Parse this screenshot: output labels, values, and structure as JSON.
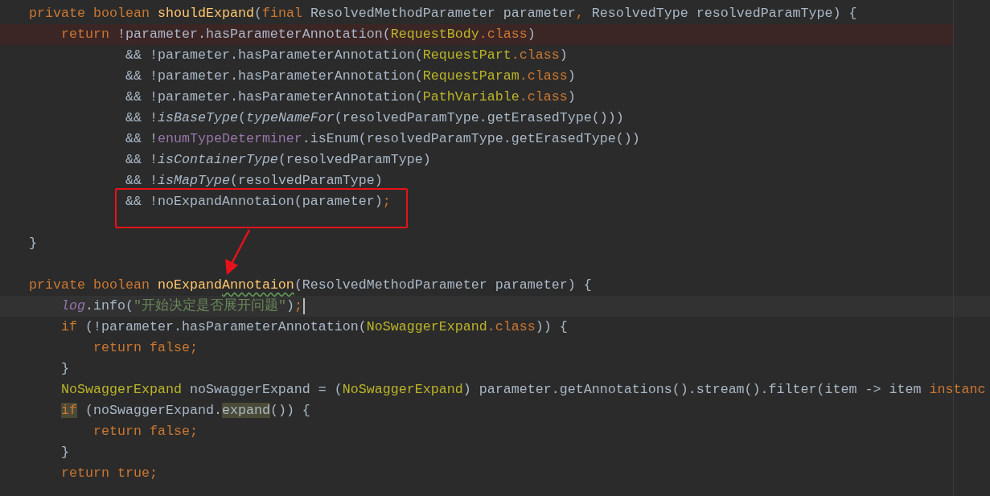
{
  "editor": {
    "lines": [
      {
        "flagged": false,
        "current": false,
        "tokens": [
          {
            "text": "private ",
            "kind": "keyword"
          },
          {
            "text": "boolean ",
            "kind": "keyword"
          },
          {
            "text": "shouldExpand",
            "kind": "declaration"
          },
          {
            "text": "(",
            "kind": "plain"
          },
          {
            "text": "final ",
            "kind": "keyword"
          },
          {
            "text": "ResolvedMethodParameter parameter",
            "kind": "plain"
          },
          {
            "text": ", ",
            "kind": "keyword"
          },
          {
            "text": "ResolvedType resolvedParamType) {",
            "kind": "plain"
          }
        ]
      },
      {
        "flagged": true,
        "current": false,
        "tokens": [
          {
            "text": "    return ",
            "kind": "keyword"
          },
          {
            "text": "!parameter.hasParameterAnnotation(",
            "kind": "plain"
          },
          {
            "text": "RequestBody",
            "kind": "type"
          },
          {
            "text": ".class",
            "kind": "keyword"
          },
          {
            "text": ")",
            "kind": "plain"
          }
        ]
      },
      {
        "flagged": false,
        "current": false,
        "tokens": [
          {
            "text": "            && !parameter.hasParameterAnnotation(",
            "kind": "plain"
          },
          {
            "text": "RequestPart",
            "kind": "type"
          },
          {
            "text": ".class",
            "kind": "keyword"
          },
          {
            "text": ")",
            "kind": "plain"
          }
        ]
      },
      {
        "flagged": false,
        "current": false,
        "tokens": [
          {
            "text": "            && !parameter.hasParameterAnnotation(",
            "kind": "plain"
          },
          {
            "text": "RequestParam",
            "kind": "type"
          },
          {
            "text": ".class",
            "kind": "keyword"
          },
          {
            "text": ")",
            "kind": "plain"
          }
        ]
      },
      {
        "flagged": false,
        "current": false,
        "tokens": [
          {
            "text": "            && !parameter.hasParameterAnnotation(",
            "kind": "plain"
          },
          {
            "text": "PathVariable",
            "kind": "type"
          },
          {
            "text": ".class",
            "kind": "keyword"
          },
          {
            "text": ")",
            "kind": "plain"
          }
        ]
      },
      {
        "flagged": false,
        "current": false,
        "tokens": [
          {
            "text": "            && !",
            "kind": "plain"
          },
          {
            "text": "isBaseType",
            "kind": "static"
          },
          {
            "text": "(",
            "kind": "plain"
          },
          {
            "text": "typeNameFor",
            "kind": "static"
          },
          {
            "text": "(resolvedParamType.getErasedType()))",
            "kind": "plain"
          }
        ]
      },
      {
        "flagged": false,
        "current": false,
        "tokens": [
          {
            "text": "            && !",
            "kind": "plain"
          },
          {
            "text": "enumTypeDeterminer",
            "kind": "field"
          },
          {
            "text": ".isEnum(resolvedParamType.getErasedType())",
            "kind": "plain"
          }
        ]
      },
      {
        "flagged": false,
        "current": false,
        "tokens": [
          {
            "text": "            && !",
            "kind": "plain"
          },
          {
            "text": "isContainerType",
            "kind": "static"
          },
          {
            "text": "(resolvedParamType)",
            "kind": "plain"
          }
        ]
      },
      {
        "flagged": false,
        "current": false,
        "tokens": [
          {
            "text": "            && !",
            "kind": "plain"
          },
          {
            "text": "isMapType",
            "kind": "static"
          },
          {
            "text": "(resolvedParamType)",
            "kind": "plain"
          }
        ]
      },
      {
        "flagged": false,
        "current": false,
        "tokens": [
          {
            "text": "            && !noExpandAnnotaion(parameter)",
            "kind": "plain"
          },
          {
            "text": ";",
            "kind": "keyword"
          }
        ]
      },
      {
        "flagged": false,
        "current": false
      },
      {
        "flagged": false,
        "current": false,
        "tokens": [
          {
            "text": "}",
            "kind": "plain"
          }
        ]
      },
      {
        "flagged": false,
        "current": false
      },
      {
        "flagged": false,
        "current": false,
        "tokens": [
          {
            "text": "private ",
            "kind": "keyword"
          },
          {
            "text": "boolean ",
            "kind": "keyword"
          },
          {
            "text": "noExpand",
            "kind": "declaration"
          },
          {
            "text": "Annotaion",
            "kind": "declaration",
            "typo": true
          },
          {
            "text": "(ResolvedMethodParameter parameter) {",
            "kind": "plain"
          }
        ]
      },
      {
        "flagged": false,
        "current": true,
        "tokens": [
          {
            "text": "    log",
            "kind": "static_field"
          },
          {
            "text": ".info(",
            "kind": "plain"
          },
          {
            "text": "\"开始决定是否展开问题\"",
            "kind": "string"
          },
          {
            "text": ")",
            "kind": "plain"
          },
          {
            "text": ";",
            "kind": "keyword"
          }
        ]
      },
      {
        "flagged": false,
        "current": false,
        "tokens": [
          {
            "text": "    if ",
            "kind": "keyword"
          },
          {
            "text": "(!parameter.hasParameterAnnotation(",
            "kind": "plain"
          },
          {
            "text": "NoSwaggerExpand",
            "kind": "type"
          },
          {
            "text": ".class",
            "kind": "keyword"
          },
          {
            "text": ")) {",
            "kind": "plain"
          }
        ]
      },
      {
        "flagged": false,
        "current": false,
        "tokens": [
          {
            "text": "        return false;",
            "kind": "keyword"
          }
        ]
      },
      {
        "flagged": false,
        "current": false,
        "tokens": [
          {
            "text": "    }",
            "kind": "plain"
          }
        ]
      },
      {
        "flagged": false,
        "current": false,
        "tokens": [
          {
            "text": "    NoSwaggerExpand",
            "kind": "type"
          },
          {
            "text": " noSwaggerExpand = (",
            "kind": "plain"
          },
          {
            "text": "NoSwaggerExpand",
            "kind": "type"
          },
          {
            "text": ") parameter.getAnnotations().stream().filter(item -> item ",
            "kind": "plain"
          },
          {
            "text": "instanc",
            "kind": "keyword"
          }
        ]
      },
      {
        "flagged": false,
        "current": false,
        "tokens": [
          {
            "text": "    if",
            "kind": "keyword",
            "usage": true
          },
          {
            "text": " (noSwaggerExpand.",
            "kind": "plain"
          },
          {
            "text": "expand",
            "kind": "plain",
            "usage": true
          },
          {
            "text": "()) {",
            "kind": "plain"
          }
        ]
      },
      {
        "flagged": false,
        "current": false,
        "tokens": [
          {
            "text": "        return false;",
            "kind": "keyword"
          }
        ]
      },
      {
        "flagged": false,
        "current": false,
        "tokens": [
          {
            "text": "    }",
            "kind": "plain"
          }
        ]
      },
      {
        "flagged": false,
        "current": false,
        "tokens": [
          {
            "text": "    return true;",
            "kind": "keyword"
          }
        ]
      }
    ]
  }
}
